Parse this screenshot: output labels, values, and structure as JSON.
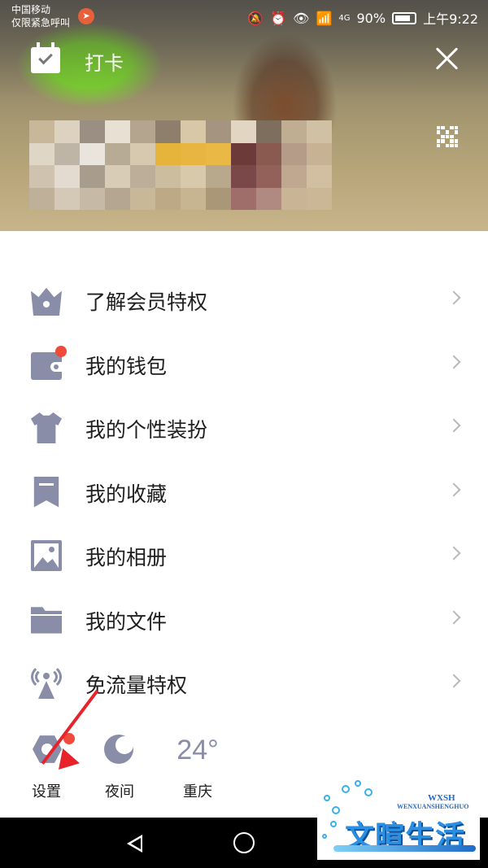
{
  "status_bar": {
    "carrier_line1": "中国移动",
    "carrier_line2": "仅限紧急呼叫",
    "network": "4G",
    "battery": "90%",
    "time": "上午9:22"
  },
  "header": {
    "checkin_label": "打卡"
  },
  "menu": {
    "items": [
      {
        "label": "了解会员特权",
        "icon": "crown-icon"
      },
      {
        "label": "我的钱包",
        "icon": "wallet-icon",
        "badge": true
      },
      {
        "label": "我的个性装扮",
        "icon": "shirt-icon"
      },
      {
        "label": "我的收藏",
        "icon": "bookmark-icon"
      },
      {
        "label": "我的相册",
        "icon": "photo-icon"
      },
      {
        "label": "我的文件",
        "icon": "folder-icon"
      },
      {
        "label": "免流量特权",
        "icon": "antenna-icon"
      }
    ]
  },
  "toolbar": {
    "settings_label": "设置",
    "night_label": "夜间",
    "weather_temp": "24°",
    "weather_city": "重庆"
  },
  "watermark": {
    "abbr": "WXSH",
    "pinyin": "WENXUANSHENGHUO",
    "text": "文暄生活"
  },
  "colors": {
    "icon_gray": "#8a8da8",
    "badge_red": "#f04a3c",
    "arrow_red": "#e8222a"
  }
}
